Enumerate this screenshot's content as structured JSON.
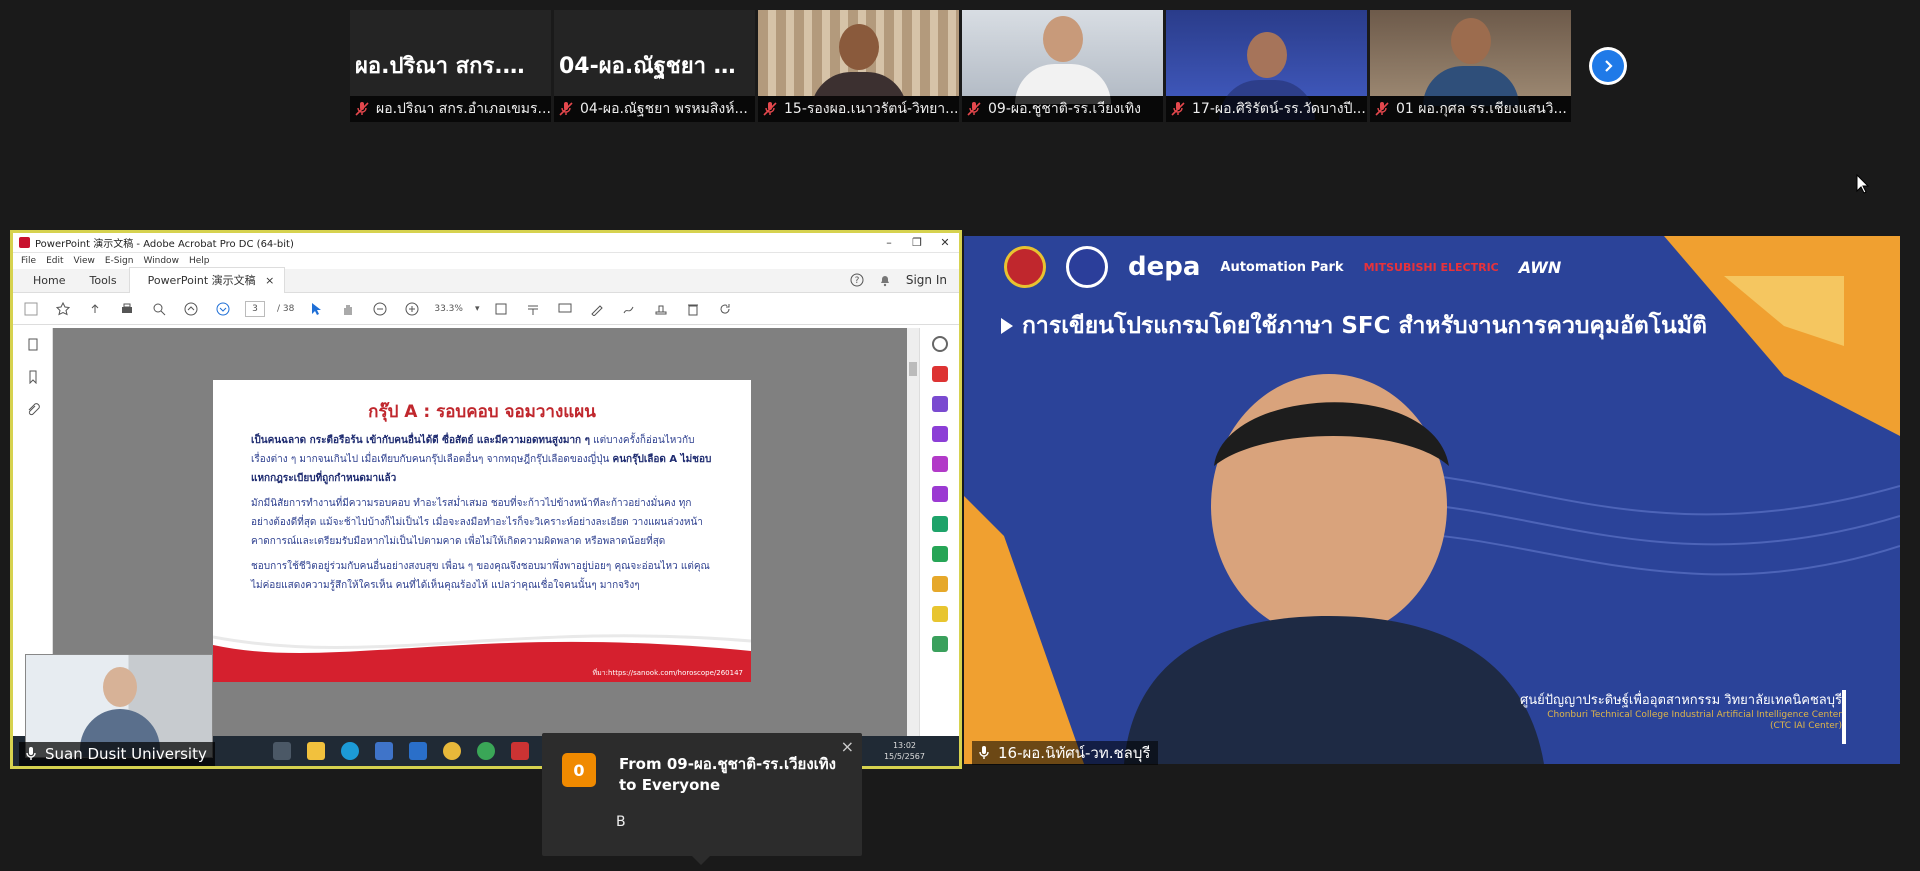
{
  "participants": [
    {
      "big_name": "ผอ.ปริณา สกร.อำ...",
      "label": "ผอ.ปริณา สกร.อำเภอเขมร..."
    },
    {
      "big_name": "04-ผอ.ณัฐชยา พ...",
      "label": "04-ผอ.ณัฐชยา พรหมสิงห์..."
    },
    {
      "big_name": "",
      "label": "15-รองผอ.เนาวรัตน์-วิทยา..."
    },
    {
      "big_name": "",
      "label": "09-ผอ.ชูชาติ-รร.เวียงเทิง"
    },
    {
      "big_name": "",
      "label": "17-ผอ.ศิริรัตน์-รร.วัดบางปี..."
    },
    {
      "big_name": "",
      "label": "01 ผอ.กุศล รร.เชียงแสนวิ..."
    }
  ],
  "shared_screen": {
    "window_title": "PowerPoint 演示文稿 - Adobe Acrobat Pro DC (64-bit)",
    "menu": [
      "File",
      "Edit",
      "View",
      "E-Sign",
      "Window",
      "Help"
    ],
    "tabs": {
      "home": "Home",
      "tools": "Tools",
      "doc": "PowerPoint 演示文稿",
      "doc_close": "×",
      "sign_in": "Sign In"
    },
    "page_current": "3",
    "page_total": "/ 38",
    "zoom": "33.3%",
    "doc_heading": "กรุ๊ป A : รอบคอบ จอมวางแผน",
    "doc_para1_bold": "เป็นคนฉลาด กระตือรือร้น เข้ากับคนอื่นได้ดี ซื่อสัตย์ และมีความอดทนสูงมาก ๆ",
    "doc_para1_rest": " แต่บางครั้งก็อ่อนไหวกับเรื่องต่าง ๆ มากจนเกินไป เมื่อเทียบกับคนกรุ๊ปเลือดอื่นๆ จากทฤษฎีกรุ๊ปเลือดของญี่ปุ่น",
    "doc_para1_tail": "คนกรุ๊ปเลือด A ไม่ชอบแหกกฎระเบียบที่ถูกกำหนดมาแล้ว",
    "doc_para2": "มักมีนิสัยการทำงานที่มีความรอบคอบ ทำอะไรสม่ำเสมอ ชอบที่จะก้าวไปข้างหน้าทีละก้าวอย่างมั่นคง ทุกอย่างต้องดีที่สุด แม้จะช้าไปบ้างก็ไม่เป็นไร เมื่อจะลงมือทำอะไรก็จะวิเคราะห์อย่างละเอียด วางแผนล่วงหน้า คาดการณ์และเตรียมรับมือหากไม่เป็นไปตามคาด เพื่อไม่ให้เกิดความผิดพลาด หรือพลาดน้อยที่สุด",
    "doc_para3": "ชอบการใช้ชีวิตอยู่ร่วมกับคนอื่นอย่างสงบสุข เพื่อน ๆ ของคุณจึงชอบมาพึ่งพาอยู่บ่อยๆ คุณจะอ่อนไหว แต่คุณไม่ค่อยแสดงความรู้สึกให้ใครเห็น คนที่ได้เห็นคุณร้องไห้ แปลว่าคุณเชื่อใจคนนั้นๆ มากจริงๆ",
    "doc_source": "ที่มา:https://sanook.com/horoscope/260147",
    "clock_time": "13:02",
    "clock_date": "15/5/2567"
  },
  "presenter_label": "Suan Dusit University",
  "speaker": {
    "logos_text": [
      "depa",
      "Automation Park",
      "MITSUBISHI ELECTRIC",
      "AWN"
    ],
    "title": "การเขียนโปรแกรมโดยใช้ภาษา SFC สำหรับงานการควบคุมอัตโนมัติ",
    "org_th": "ศูนย์ปัญญาประดิษฐ์เพื่ออุตสาหกรรม วิทยาลัยเทคนิคชลบุรี",
    "org_en": "Chonburi Technical College Industrial Artificial Intelligence Center",
    "org_short": "(CTC IAI Center)",
    "label": "16-ผอ.นิทัศน์-วท.ชลบุรี"
  },
  "chat_toast": {
    "badge": "0",
    "from": "From 09-ผอ.ชูชาติ-รร.เวียงเทิง to Everyone",
    "message": "B",
    "close": "×"
  },
  "colors": {
    "share_border": "#d6d24f",
    "toast_badge": "#f08a00",
    "mic_off": "#e5484d",
    "next_button": "#1f7ae8"
  }
}
